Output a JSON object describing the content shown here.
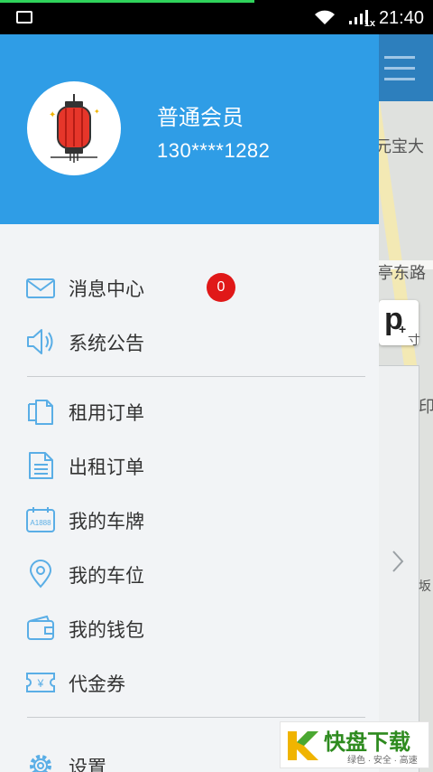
{
  "status_bar": {
    "time": "21:40",
    "net_speed": "1x"
  },
  "map": {
    "labels": [
      "元宝大",
      "亭东路",
      "寸",
      "印",
      "坂"
    ]
  },
  "profile": {
    "member_level": "普通会员",
    "phone": "130****1282"
  },
  "menu": {
    "messages": {
      "label": "消息中心",
      "badge": "0"
    },
    "announcements": {
      "label": "系统公告"
    },
    "rent_orders": {
      "label": "租用订单"
    },
    "lease_orders": {
      "label": "出租订单"
    },
    "my_plates": {
      "label": "我的车牌",
      "icon_text": "A1888"
    },
    "my_spaces": {
      "label": "我的车位"
    },
    "my_wallet": {
      "label": "我的钱包"
    },
    "vouchers": {
      "label": "代金券",
      "icon_text": "¥"
    },
    "settings": {
      "label": "设置"
    }
  },
  "watermark": {
    "title": "快盘下载",
    "subtitle": "绿色 · 安全 · 高速"
  },
  "colors": {
    "header": "#2f9de6",
    "icon": "#5aaee6",
    "badge": "#e01818",
    "drawer_bg": "#f2f4f6"
  }
}
